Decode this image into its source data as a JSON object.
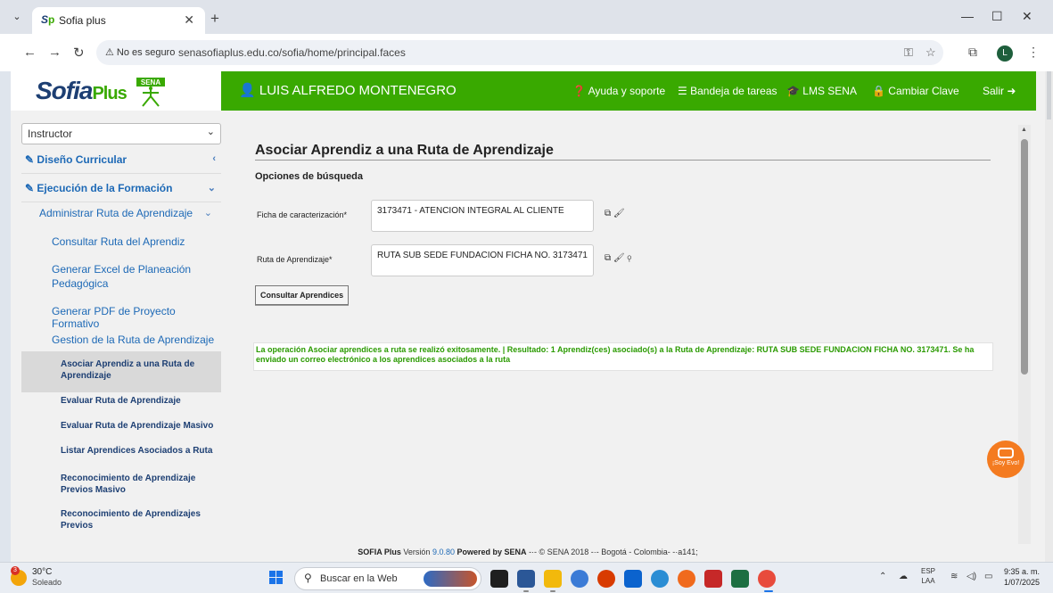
{
  "browser": {
    "tab_title": "Sofia plus",
    "tab_favicon": "S",
    "security_label": "⚠ No es seguro",
    "url": "senasofiaplus.edu.co/sofia/home/principal.faces",
    "profile_initial": "L"
  },
  "header": {
    "logo_main": "Sofia",
    "logo_sub": "Plus",
    "sena_text": "SENA",
    "user_name": "LUIS ALFREDO MONTENEGRO",
    "links": {
      "help": "Ayuda y soporte",
      "tasks": "Bandeja de tareas",
      "lms": "LMS SENA",
      "password": "Cambiar Clave",
      "logout": "Salir"
    }
  },
  "sidebar": {
    "role": "Instructor",
    "items": [
      {
        "label": "Diseño Curricular"
      },
      {
        "label": "Ejecución de la Formación"
      },
      {
        "label": "Administrar Ruta de Aprendizaje"
      },
      {
        "label": "Consultar Ruta del Aprendiz"
      },
      {
        "label": "Generar Excel de Planeación Pedagógica"
      },
      {
        "label": "Generar PDF de Proyecto Formativo"
      },
      {
        "label": "Gestion de la Ruta de Aprendizaje"
      },
      {
        "label": "Asociar Aprendiz a una Ruta de Aprendizaje"
      },
      {
        "label": "Evaluar Ruta de Aprendizaje"
      },
      {
        "label": "Evaluar Ruta de Aprendizaje Masivo"
      },
      {
        "label": "Listar Aprendices Asociados a Ruta"
      },
      {
        "label": "Reconocimiento de Aprendizaje Previos Masivo"
      },
      {
        "label": "Reconocimiento de Aprendizajes Previos"
      }
    ]
  },
  "main": {
    "title": "Asociar Aprendiz a una Ruta de Aprendizaje",
    "search_legend": "Opciones de búsqueda",
    "ficha_label": "Ficha de caracterización*",
    "ficha_value": "3173471 - ATENCION INTEGRAL AL CLIENTE",
    "ruta_label": "Ruta de Aprendizaje*",
    "ruta_value": "RUTA SUB SEDE FUNDACION FICHA NO. 3173471",
    "consult_button": "Consultar Aprendices",
    "success_message": "La operación Asociar aprendices a ruta se realizó exitosamente. | Resultado: 1 Aprendiz(ces) asociado(s) a la Ruta de Aprendizaje: RUTA SUB SEDE FUNDACION FICHA NO. 3173471. Se ha enviado un correo electrónico a los aprendices asociados a la ruta"
  },
  "chat": {
    "label": "¡Soy Evo!"
  },
  "footer": {
    "product": "SOFIA Plus",
    "version_label": "Versión",
    "version": "9.0.80",
    "powered": "Powered by SENA",
    "rest": "-·- © SENA 2018 -·- Bogotá - Colombia- -·a141;"
  },
  "taskbar": {
    "temperature": "30°C",
    "weather": "Soleado",
    "weather_badge": "3",
    "search_placeholder": "Buscar en la Web",
    "lang_top": "ESP",
    "lang_bottom": "LAA",
    "time": "9:35 a. m.",
    "date": "1/07/2025"
  },
  "colors": {
    "sena_green": "#39a900",
    "link_blue": "#1d69b6",
    "navy": "#1d3f73",
    "success_green": "#2a9a00",
    "chat_orange": "#f47b20"
  }
}
